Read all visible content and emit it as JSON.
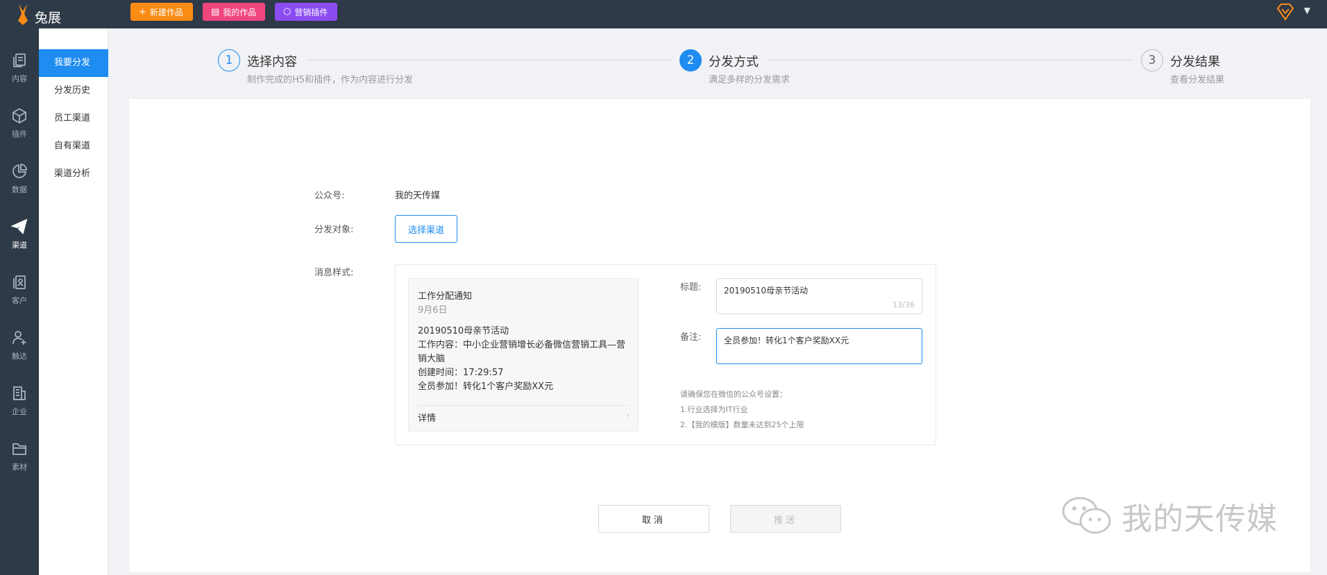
{
  "app": {
    "logo_text": "兔展"
  },
  "topbar": {
    "new_label": "新建作品",
    "mine_label": "我的作品",
    "plugin_label": "营销插件",
    "caret": "▼"
  },
  "iconbar": [
    {
      "label": "内容",
      "icon": "copy-icon"
    },
    {
      "label": "插件",
      "icon": "cube-icon"
    },
    {
      "label": "数据",
      "icon": "pie-chart-icon"
    },
    {
      "label": "渠道",
      "icon": "send-icon"
    },
    {
      "label": "客户",
      "icon": "contacts-icon"
    },
    {
      "label": "触达",
      "icon": "user-add-icon"
    },
    {
      "label": "企业",
      "icon": "building-icon"
    },
    {
      "label": "素材",
      "icon": "folder-icon"
    }
  ],
  "submenu": [
    {
      "label": "我要分发"
    },
    {
      "label": "分发历史"
    },
    {
      "label": "员工渠道"
    },
    {
      "label": "自有渠道"
    },
    {
      "label": "渠道分析"
    }
  ],
  "steps": [
    {
      "num": "1",
      "title": "选择内容",
      "desc": "制作完成的H5和插件，作为内容进行分发"
    },
    {
      "num": "2",
      "title": "分发方式",
      "desc": "满足多样的分发需求"
    },
    {
      "num": "3",
      "title": "分发结果",
      "desc": "查看分发结果"
    }
  ],
  "form": {
    "account_label": "公众号:",
    "account_value": "我的天传媒",
    "target_label": "分发对象:",
    "select_channel": "选择渠道",
    "style_label": "消息样式:",
    "title_label": "标题:",
    "title_value": "20190510母亲节活动",
    "title_counter": "13/36",
    "note_label": "备注:",
    "note_value": "全员参加！转化1个客户奖励XX元"
  },
  "preview": {
    "heading": "工作分配通知",
    "date": "9月6日",
    "lines": [
      "20190510母亲节活动",
      "工作内容：中小企业营销增长必备微信营销工具—营销大脑",
      "创建时间：17:29:57",
      "全员参加！转化1个客户奖励XX元"
    ],
    "detail": "详情",
    "arrow": "›"
  },
  "hints": [
    "请确保您在微信的公众号设置：",
    "1.行业选择为IT行业",
    "2.【我的模版】数量未达到25个上限"
  ],
  "actions": {
    "cancel": "取消",
    "push": "推送"
  },
  "watermark": {
    "text": "我的天传媒"
  }
}
